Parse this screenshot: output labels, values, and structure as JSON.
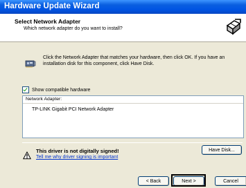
{
  "window": {
    "title": "Hardware Update Wizard"
  },
  "header": {
    "title": "Select Network Adapter",
    "subtitle": "Which network adapter do you want to install?",
    "icon": "hardware-wizard-icon"
  },
  "body": {
    "icon": "network-card-icon",
    "instructions": "Click the Network Adapter that matches your hardware, then click OK. If you have an installation disk for this component, click Have Disk.",
    "show_compatible": {
      "label": "Show compatible hardware",
      "checked": true
    },
    "list": {
      "header": "Network Adapter:",
      "items": [
        "TP-LINK Gigabit PCI Network Adapter"
      ]
    }
  },
  "warning": {
    "icon": "unsigned-driver-warning-icon",
    "title": "This driver is not digitally signed!",
    "link": "Tell me why driver signing is important"
  },
  "buttons": {
    "have_disk": "Have Disk...",
    "back": "< Back",
    "next": "Next >",
    "cancel": "Cancel"
  },
  "colors": {
    "titlebar": "#0054e3",
    "dialog_bg": "#ece9d8",
    "link": "#0033cc",
    "highlight_box": "#000000"
  }
}
